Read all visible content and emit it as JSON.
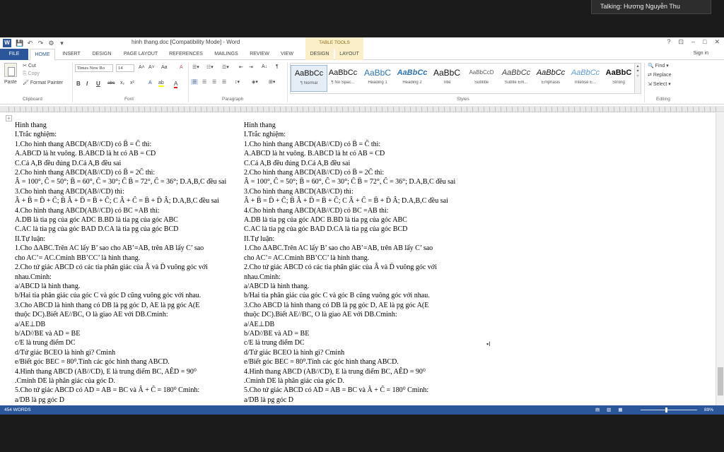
{
  "notification": {
    "text": "Talking: Hương Nguyễn Thu"
  },
  "window": {
    "title": "hinh thang.doc [Compatibility Mode] - Word",
    "context_tab_group": "TABLE TOOLS",
    "controls": [
      "?",
      "⊡",
      "–",
      "□",
      "✕"
    ]
  },
  "qat": [
    "💾",
    "↶",
    "↷",
    "⚙",
    "▾"
  ],
  "tabs": {
    "file": "FILE",
    "home": "HOME",
    "insert": "INSERT",
    "design": "DESIGN",
    "page_layout": "PAGE LAYOUT",
    "references": "REFERENCES",
    "mailings": "MAILINGS",
    "review": "REVIEW",
    "view": "VIEW",
    "table_design": "DESIGN",
    "table_layout": "LAYOUT",
    "sign_in": "Sign in"
  },
  "ribbon": {
    "clipboard": {
      "paste": "Paste",
      "cut": "Cut",
      "copy": "Copy",
      "format_painter": "Format Painter",
      "label": "Clipboard"
    },
    "font": {
      "name": "Times New Ro",
      "size": "14",
      "label": "Font",
      "bold": "B",
      "italic": "I",
      "underline": "U",
      "strike": "abc",
      "sub": "x₂",
      "sup": "x²",
      "grow": "A˄",
      "shrink": "A˅",
      "case": "Aa",
      "clear": "A",
      "highlight": "ab",
      "color": "A"
    },
    "paragraph": {
      "label": "Paragraph",
      "sort": "A↓",
      "pilcrow": "¶"
    },
    "styles": {
      "label": "Styles",
      "items": [
        {
          "preview": "AaBbCc",
          "name": "¶ Normal"
        },
        {
          "preview": "AaBbCc",
          "name": "¶ No Spac..."
        },
        {
          "preview": "AaBbC",
          "name": "Heading 1"
        },
        {
          "preview": "AaBbCc",
          "name": "Heading 2"
        },
        {
          "preview": "AaBbC",
          "name": "Title"
        },
        {
          "preview": "AaBbCcD",
          "name": "Subtitle"
        },
        {
          "preview": "AaBbCc",
          "name": "Subtle Em..."
        },
        {
          "preview": "AaBbCc",
          "name": "Emphasis"
        },
        {
          "preview": "AaBbCc",
          "name": "Intense E..."
        },
        {
          "preview": "AaBbC",
          "name": "Strong"
        }
      ]
    },
    "editing": {
      "label": "Editing",
      "find": "Find",
      "replace": "Replace",
      "select": "Select"
    }
  },
  "document": {
    "left_column": [
      "Hinh thang",
      "I.Trắc nghiệm:",
      "1.Cho hình thang ABCD(AB//CD) có B̂ = Ĉ thì:",
      "A.ABCD là ht vuông.   B.ABCD là ht có AB = CD",
      "C.Cả A,B đều đúng         D.Cả A,B đều sai",
      "2.Cho hình thang ABCD(AB//CD) có B̂ = 2Ĉ thì:",
      "Â = 100°, Ĉ = 50°; B̂ = 60°, Ĉ = 30°; Ĉ B̂ = 72°, Ĉ = 36°; D.A,B,C đều sai",
      "3.Cho hình thang ABCD(AB//CD) thì:",
      "Â + B̂ = D̂ + Ĉ; B̂ Â + D̂ = B̂ + Ĉ; C Â + Ĉ = B̂ + D̂ Â; D.A,B,C đều sai",
      "4.Cho hình thang ABCD(AB//CD) có BC =AB thì:",
      "A.DB là tia pg của góc ADC    B.BD là tia pg của góc ABC",
      "C.AC là tia pg của góc BAD    D.CA là tia pg của góc BCD",
      "II.Tự luận:",
      "1.Cho ΔABC.Trên AC lấy B’ sao cho AB’=AB, trên AB lấy C’ sao",
      "cho AC’= AC.Cminh BB’CC’ là hình thang.",
      "2.Cho tứ giác ABCD có các tia phân giác của Â và D̂ vuông góc với",
      "nhau.Cminh:",
      "a/ABCD là hình thang.",
      "b/Hai tia phân giác của góc C và góc D cũng vuông góc với nhau.",
      "3.Cho ABCD là hình thang có DB là pg góc D, AE là pg góc A(E",
      "thuộc DC).Biết AE//BC, O là giao AE với DB.Cminh:",
      "a/AE⊥DB",
      "b/AD//BE và AD = BE",
      "c/E là trung điểm DC",
      "d/Tứ giác BCEO là hình gì? Cminh",
      "e/Biết góc BEC = 80⁰.Tính các góc hình thang ABCD.",
      "4.Hình thang ABCD (AB//CD), E là trung điểm BC, AÊD = 90⁰",
      ".Cminh DE là phân giác của góc D.",
      "5.Cho tứ giác ABCD có AD = AB = BC và Â + Ĉ = 180⁰ Cminh:",
      "a/DB là pg góc D",
      "b/ ADC = BCD"
    ],
    "right_column": [
      "Hinh thang",
      "I.Trắc nghiệm:",
      "1.Cho hình thang ABCD(AB//CD) có B̂ = Ĉ thì:",
      "A.ABCD là ht vuông.   B.ABCD là ht có AB = CD",
      "C.Cả A,B đều đúng         D.Cả A,B đều sai",
      "2.Cho hình thang ABCD(AB//CD) có B̂ = 2Ĉ thì:",
      "Â = 100°, Ĉ = 50°; B̂ = 60°, Ĉ = 30°; Ĉ B̂ = 72°, Ĉ = 36°; D.A,B,C đều sai",
      "3.Cho hình thang ABCD(AB//CD) thì:",
      "Â + B̂ = D̂ + Ĉ; B̂ Â + D̂ = B̂ + Ĉ; C Â + Ĉ = B̂ + D̂ Â; D.A,B,C đều sai",
      "4.Cho hình thang ABCD(AB//CD) có BC =AB thì:",
      "A.DB là tia pg của góc ADC    B.BD là tia pg của góc ABC",
      "C.AC là tia pg của góc BAD    D.CA là tia pg của góc BCD",
      "II.Tự luận:",
      "1.Cho ΔABC.Trên AC lấy B’ sao cho AB’=AB, trên AB lấy C’ sao",
      "cho AC’= AC.Cminh BB’CC’ là hình thang.",
      "2.Cho tứ giác ABCD có các tia phân giác của Â và D̂ vuông góc với",
      "nhau.Cminh:",
      "a/ABCD là hình thang.",
      "b/Hai tia phân giác của góc C và góc B cũng vuông góc với nhau.",
      "3.Cho ABCD là hình thang có DB là pg góc D, AE là pg góc A(E",
      "thuộc DC).Biết AE//BC, O là giao AE với DB.Cminh:",
      "a/AE⊥DB",
      "b/AD//BE và AD = BE",
      "c/E là trung điểm DC",
      "d/Tứ giác BCEO là hình gì? Cminh",
      "e/Biết góc BEC = 80⁰.Tính các góc hình thang ABCD.",
      "4.Hình thang ABCD (AB//CD), E là trung điểm BC, AÊD = 90⁰",
      ".Cminh DE là phân giác của góc D.",
      "5.Cho tứ giác ABCD có AD = AB = BC và Â + Ĉ = 180⁰ Cminh:",
      "a/DB là pg góc D",
      "b/ ADC = BCD"
    ]
  },
  "status": {
    "word_count": "454 WORDS",
    "zoom": "89%",
    "zoom_fraction": 0.45
  },
  "colors": {
    "accent": "#2b579a",
    "context_tab": "#fbefc9"
  }
}
